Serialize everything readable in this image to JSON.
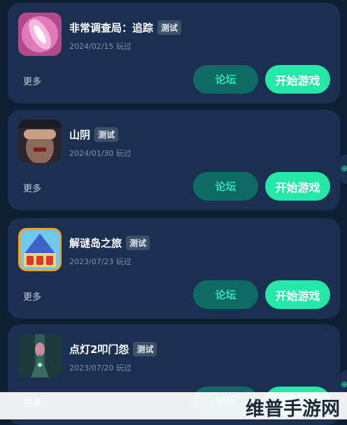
{
  "games": [
    {
      "title": "非常调查局：追踪",
      "badge": "测试",
      "date": "2024/02/15 玩过",
      "more": "更多",
      "forum": "论坛",
      "play": "开始游戏"
    },
    {
      "title": "山阴",
      "badge": "测试",
      "date": "2024/01/30 玩过",
      "more": "更多",
      "forum": "论坛",
      "play": "开始游戏"
    },
    {
      "title": "解谜岛之旅",
      "badge": "测试",
      "date": "2023/07/23 玩过",
      "more": "更多",
      "forum": "论坛",
      "play": "开始游戏"
    },
    {
      "title": "点灯2叩门怨",
      "badge": "测试",
      "date": "2023/07/20 玩过",
      "more": "更多",
      "forum": "论坛",
      "play": "开始游戏"
    }
  ],
  "watermark": "维普手游网",
  "colors": {
    "background": "#0f1f33",
    "card": "#1b3050",
    "accent": "#25e8a8",
    "forum_button": "#0e6a65",
    "badge": "#3c5068"
  },
  "icons": [
    "game-icon-investigation",
    "game-icon-shanyin",
    "game-icon-puzzle-island",
    "game-icon-diandeng"
  ]
}
